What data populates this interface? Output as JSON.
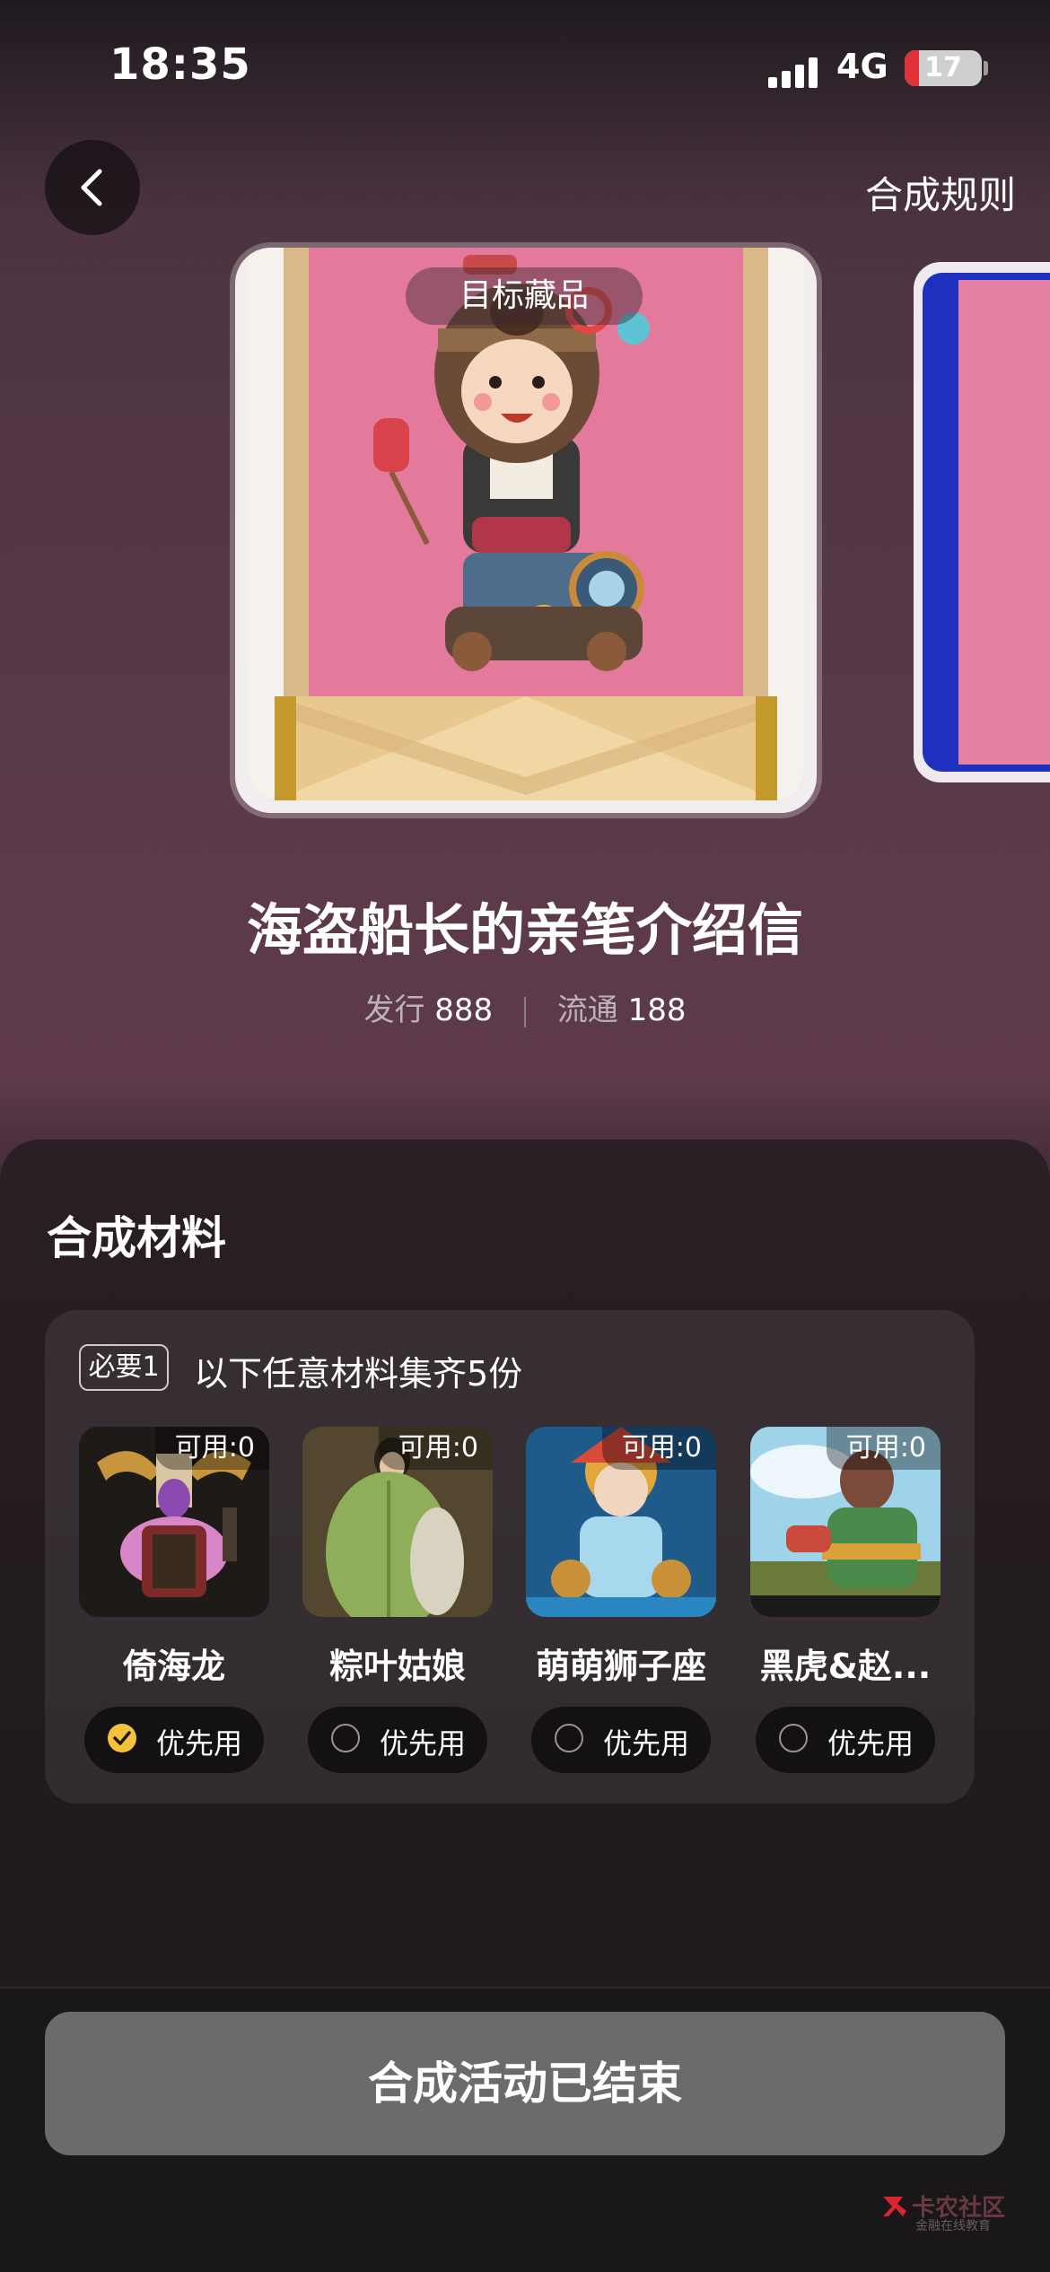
{
  "status_bar": {
    "time": "18:35",
    "network": "4G",
    "battery": "17"
  },
  "header": {
    "rules_label": "合成规则"
  },
  "hero": {
    "target_tag": "目标藏品",
    "title": "海盗船长的亲笔介绍信",
    "issue_label": "发行",
    "issue_value": "888",
    "circulation_label": "流通",
    "circulation_value": "188"
  },
  "materials": {
    "section_title": "合成材料",
    "required_tag": "必要1",
    "requirement_text": "以下任意材料集齐5份",
    "items": [
      {
        "name": "倚海龙",
        "available": "可用:0",
        "priority_label": "优先用",
        "selected": true,
        "icon": "dragon-figure-art"
      },
      {
        "name": "粽叶姑娘",
        "available": "可用:0",
        "priority_label": "优先用",
        "selected": false,
        "icon": "leaf-girl-art"
      },
      {
        "name": "萌萌狮子座",
        "available": "可用:0",
        "priority_label": "优先用",
        "selected": false,
        "icon": "leo-lion-art"
      },
      {
        "name": "黑虎&赵...",
        "available": "可用:0",
        "priority_label": "优先用",
        "selected": false,
        "icon": "black-tiger-zhao-art"
      }
    ]
  },
  "footer": {
    "button_label": "合成活动已结束",
    "watermark_main": "卡农社区",
    "watermark_sub": "金融在线教育"
  },
  "colors": {
    "accent_check": "#f6c23b",
    "card_pink": "#e37a9c",
    "button_disabled": "#6c6a6c"
  }
}
